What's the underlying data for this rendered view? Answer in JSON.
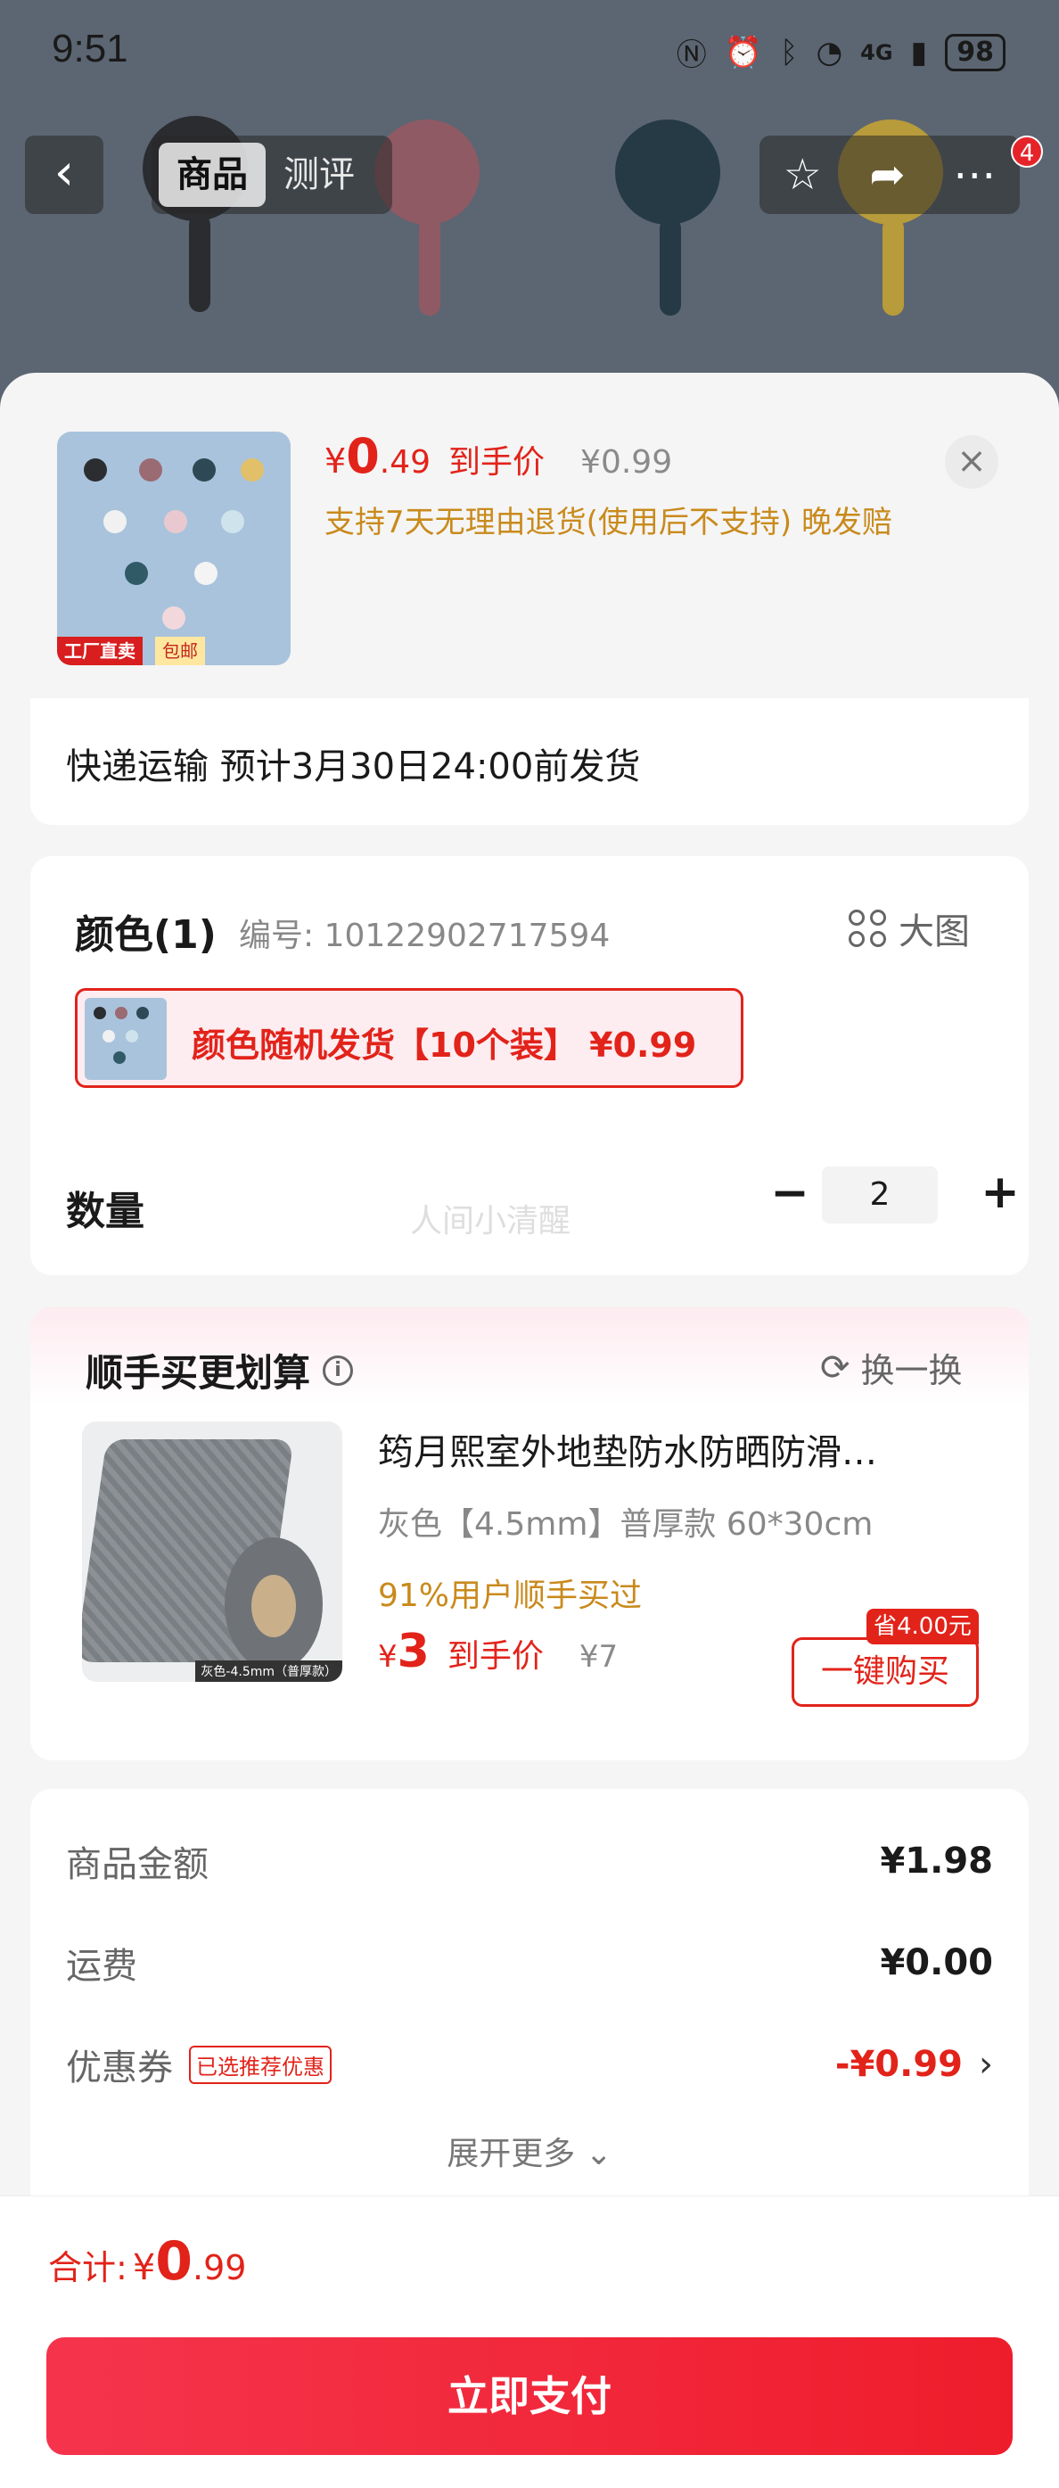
{
  "status_bar": {
    "time": "9:51",
    "network": "4G",
    "battery": "98"
  },
  "nav": {
    "back_icon": "‹",
    "tabs": [
      {
        "label": "商品",
        "active": true
      },
      {
        "label": "测评",
        "active": false
      }
    ],
    "cart_badge": "4"
  },
  "product": {
    "price_symbol": "¥",
    "price_int": "0",
    "price_dec": ".49",
    "price_label": "到手价",
    "original_price": "¥0.99",
    "return_note": "支持7天无理由退货(使用后不支持) 晚发赔",
    "thumb_tag_factory": "工厂直卖",
    "thumb_tag_shipping": "包邮"
  },
  "shipping": {
    "text": "快递运输 预计3月30日24:00前发货"
  },
  "spec": {
    "color_title": "颜色(1)",
    "sku_code": "编号: 10122902717594",
    "big_image": "大图",
    "color_option": "颜色随机发货【10个装】 ¥0.99",
    "qty_label": "数量",
    "watermark": "人间小清醒",
    "qty_minus": "−",
    "qty_value": "2",
    "qty_plus": "+"
  },
  "upsell": {
    "title": "顺手买更划算",
    "info_icon": "i",
    "swap_label": "换一换",
    "item_title": "筠月熙室外地垫防水防晒防滑…",
    "item_spec": "灰色【4.5mm】普厚款  60*30cm",
    "buyers_note": "91%用户顺手买过",
    "price_symbol": "¥",
    "price_int": "3",
    "price_label": "到手价",
    "original_price": "¥7",
    "save_badge": "省4.00元",
    "buy_button": "一键购买",
    "image_tag": "灰色-4.5mm（普厚款）"
  },
  "summary": {
    "goods_label": "商品金额",
    "goods_value": "¥1.98",
    "freight_label": "运费",
    "freight_value": "¥0.00",
    "coupon_label": "优惠券",
    "coupon_tag": "已选推荐优惠",
    "coupon_value": "-¥0.99",
    "expand_label": "展开更多 ⌄"
  },
  "footer": {
    "total_label": "合计:",
    "total_symbol": "¥",
    "total_int": "0",
    "total_dec": ".99",
    "pay_button": "立即支付"
  },
  "colors": {
    "accent": "#e2231a",
    "gold": "#c98a1c"
  }
}
